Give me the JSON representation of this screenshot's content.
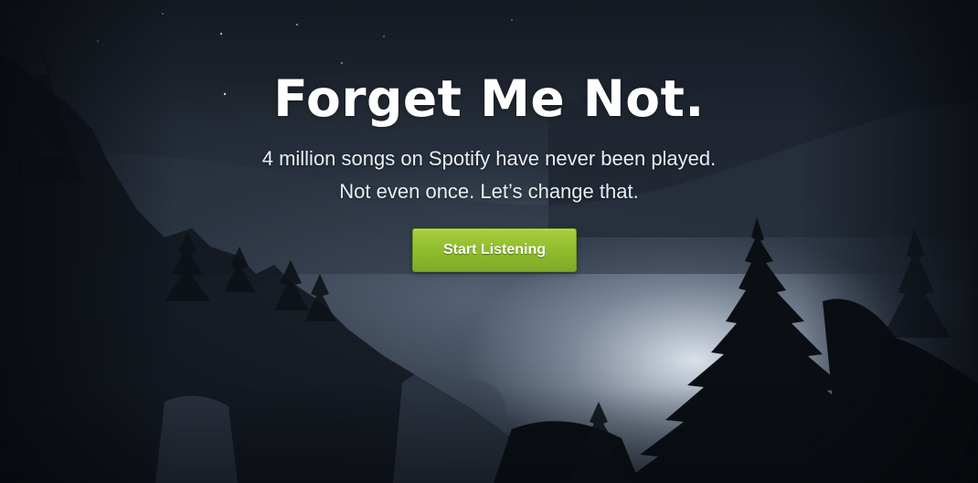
{
  "hero": {
    "title": "Forget Me Not.",
    "subtitle_line1": "4 million songs on Spotify have never been played.",
    "subtitle_line2": "Not even once. Let’s change that.",
    "cta_label": "Start Listening"
  },
  "colors": {
    "cta_green": "#8dbb2c",
    "title_white": "#ffffff",
    "night_sky": "#1d232d"
  },
  "background": {
    "scene": "misty-forest-night-icon"
  }
}
